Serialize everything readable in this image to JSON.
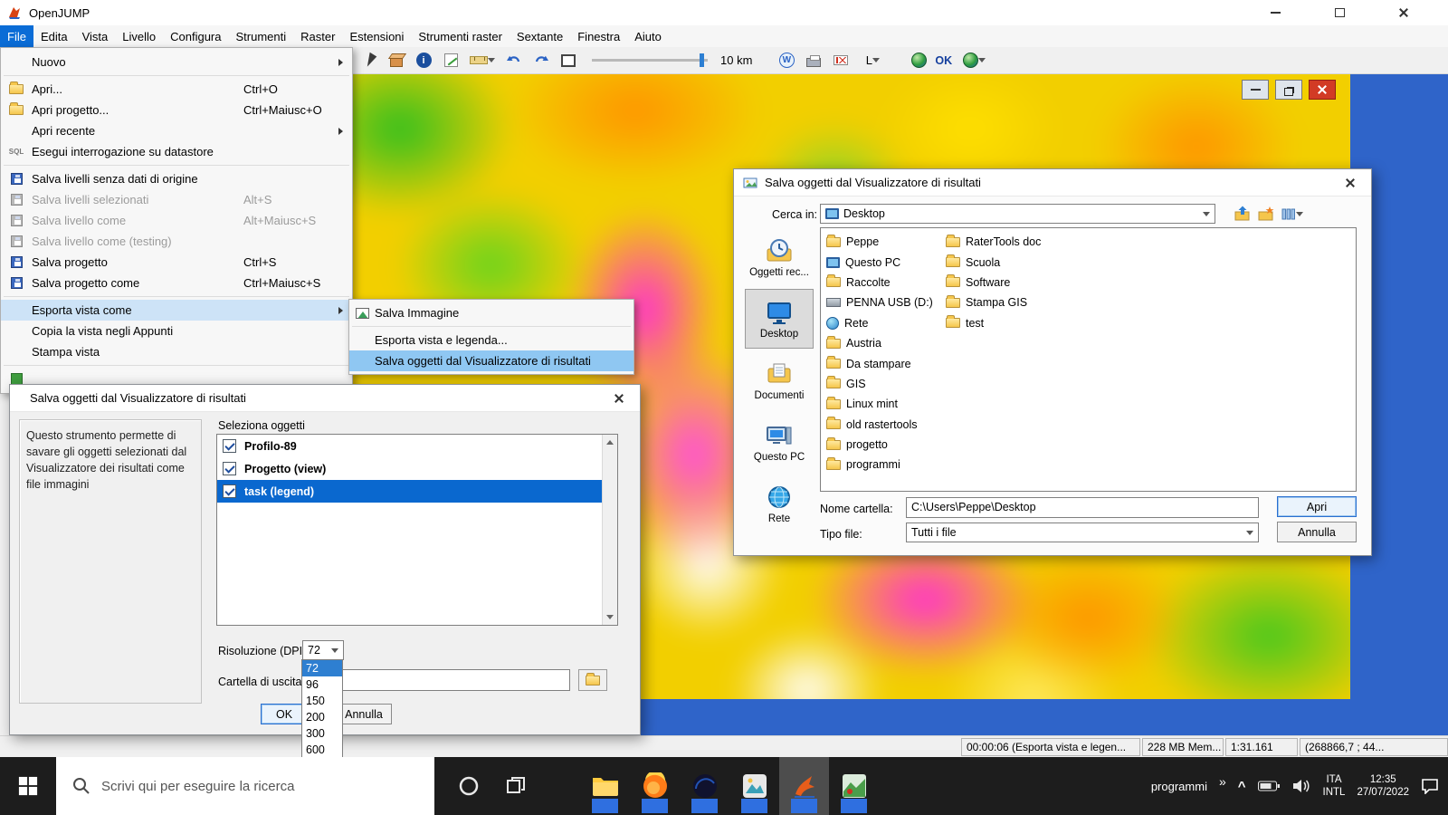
{
  "app": {
    "title": "OpenJUMP"
  },
  "menubar": {
    "items": [
      "File",
      "Edita",
      "Vista",
      "Livello",
      "Configura",
      "Strumenti",
      "Raster",
      "Estensioni",
      "Strumenti raster",
      "Sextante",
      "Finestra",
      "Aiuto"
    ]
  },
  "file_menu": {
    "sql_icon": "SQL",
    "items": [
      {
        "label": "Nuovo"
      },
      {
        "label": "Apri...",
        "shortcut": "Ctrl+O"
      },
      {
        "label": "Apri progetto...",
        "shortcut": "Ctrl+Maiusc+O"
      },
      {
        "label": "Apri recente"
      },
      {
        "label": "Esegui interrogazione su datastore"
      },
      {
        "label": "Salva livelli senza dati di origine"
      },
      {
        "label": "Salva livelli selezionati",
        "shortcut": "Alt+S"
      },
      {
        "label": "Salva livello come",
        "shortcut": "Alt+Maiusc+S"
      },
      {
        "label": "Salva livello come (testing)"
      },
      {
        "label": "Salva progetto",
        "shortcut": "Ctrl+S"
      },
      {
        "label": "Salva progetto come",
        "shortcut": "Ctrl+Maiusc+S"
      },
      {
        "label": "Esporta vista come"
      },
      {
        "label": "Copia la vista negli Appunti"
      },
      {
        "label": "Stampa vista"
      }
    ]
  },
  "export_submenu": {
    "items": [
      {
        "label": "Salva Immagine"
      },
      {
        "label": "Esporta vista e legenda..."
      },
      {
        "label": "Salva oggetti dal Visualizzatore di risultati"
      }
    ]
  },
  "toolbar": {
    "scale": "10 km",
    "layer": "L",
    "ok": "OK"
  },
  "plugin_dialog": {
    "title": "Salva oggetti dal Visualizzatore di risultati",
    "description": "Questo strumento permette di savare gli oggetti selezionati dal Visualizzatore dei risultati come file immagini",
    "select_label": "Seleziona oggetti",
    "objects": [
      {
        "label": "Profilo-89"
      },
      {
        "label": "Progetto (view)"
      },
      {
        "label": "task (legend)"
      }
    ],
    "dpi_label": "Risoluzione (DPI):",
    "dpi_value": "72",
    "dpi_options": [
      "72",
      "96",
      "150",
      "200",
      "300",
      "600"
    ],
    "output_label": "Cartella di uscita",
    "ok_label": "OK",
    "cancel_label": "Annulla"
  },
  "file_dialog": {
    "title": "Salva oggetti dal Visualizzatore di risultati",
    "look_in_label": "Cerca in:",
    "look_in_value": "Desktop",
    "places": [
      "Oggetti rec...",
      "Desktop",
      "Documenti",
      "Questo PC",
      "Rete"
    ],
    "files_col1": [
      "Peppe",
      "Questo PC",
      "Raccolte",
      "PENNA USB (D:)",
      "Rete",
      "Austria",
      "Da stampare",
      "GIS",
      "Linux mint",
      "old rastertools",
      "progetto",
      "programmi"
    ],
    "files_col2": [
      "RaterTools doc",
      "Scuola",
      "Software",
      "Stampa GIS",
      "test"
    ],
    "folder_label": "Nome cartella:",
    "folder_value": "C:\\Users\\Peppe\\Desktop",
    "type_label": "Tipo file:",
    "type_value": "Tutti i file",
    "open_label": "Apri",
    "cancel_label": "Annulla"
  },
  "statusbar": {
    "fields": [
      "00:00:06 (Esporta vista e legen...",
      "228 MB Mem...",
      "1:31.161",
      "(268866,7 ; 44..."
    ]
  },
  "taskbar": {
    "search_placeholder": "Scrivi qui per eseguire la ricerca",
    "tray": {
      "programs": "programmi",
      "more": "»",
      "chevron": "^",
      "lang_top": "ITA",
      "lang_bottom": "INTL",
      "time": "12:35",
      "date": "27/07/2022"
    }
  }
}
